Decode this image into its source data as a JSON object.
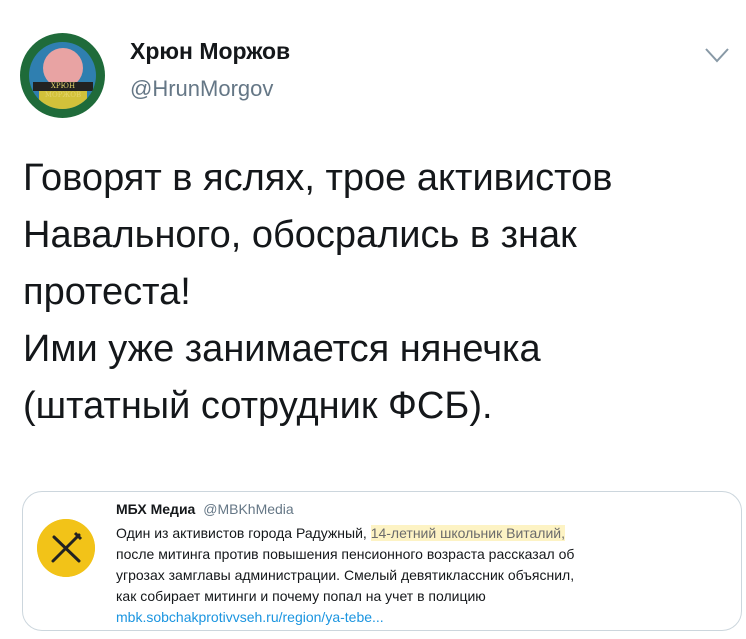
{
  "tweet": {
    "author_name": "Хрюн Моржов",
    "author_handle": "@HrunMorgov",
    "avatar_text": "ХРЮН МОРЖОВ",
    "lines": [
      "Говорят в яслях, трое активистов",
      "Навального, обосрались в знак",
      "протеста!",
      "Ими уже занимается нянечка",
      "(штатный сотрудник ФСБ)."
    ]
  },
  "quoted": {
    "name": "МБХ Медиа",
    "handle": "@MBKhMedia",
    "line1_start": "Один из активистов города Радужный,",
    "line1_highlight": "14-летний школьник Виталий,",
    "line2": "после митинга против повышения пенсионного возраста рассказал об",
    "line3": "угрозах замглавы администрации. Смелый девятиклассник объяснил,",
    "line4": "как собирает митинги и почему попал на учет в полицию",
    "link": "mbk.sobchakprotivvseh.ru/region/ya-tebe..."
  },
  "colors": {
    "text": "#14171a",
    "secondary": "#657786",
    "link": "#1b95e0",
    "highlight": "#fdf3c4",
    "logo_yellow": "#f2c318"
  }
}
